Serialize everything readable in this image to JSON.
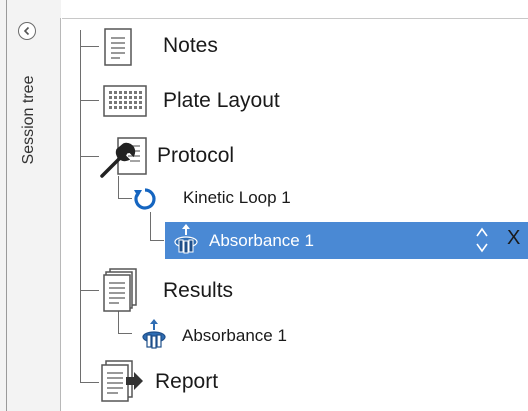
{
  "sidebar": {
    "title": "Session tree",
    "collapse_icon": "chevron-left-circle-icon"
  },
  "tree": {
    "notes": {
      "label": "Notes",
      "icon": "notes-icon"
    },
    "plate_layout": {
      "label": "Plate Layout",
      "icon": "plate-grid-icon"
    },
    "protocol": {
      "label": "Protocol",
      "icon": "wrench-document-icon"
    },
    "kinetic_loop": {
      "label": "Kinetic Loop 1",
      "icon": "loop-arrow-icon"
    },
    "absorbance_step": {
      "label": "Absorbance 1",
      "icon": "absorbance-icon",
      "selected": true
    },
    "results": {
      "label": "Results",
      "icon": "results-document-icon"
    },
    "results_absorbance": {
      "label": "Absorbance 1",
      "icon": "absorbance-icon"
    },
    "report": {
      "label": "Report",
      "icon": "report-document-icon"
    }
  },
  "selection": {
    "move_glyph": "up-down-arrows-icon",
    "remove_label": "X"
  },
  "colors": {
    "selection": "#4a89d4",
    "loop_icon": "#1565c0",
    "absorbance_icon": "#2f6db3"
  }
}
